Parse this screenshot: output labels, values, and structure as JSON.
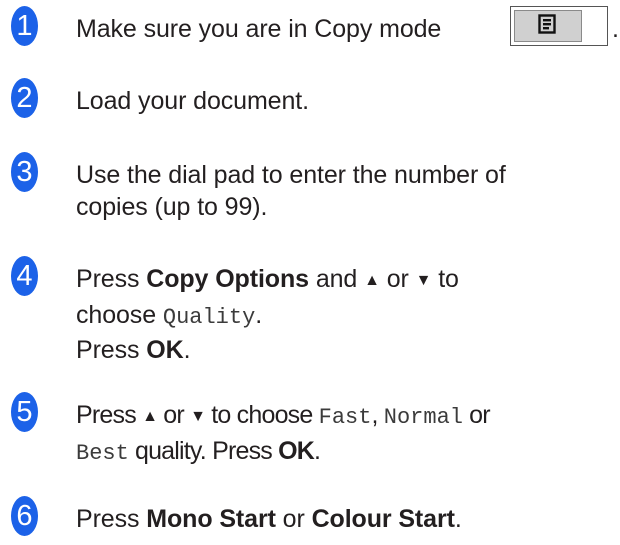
{
  "steps": [
    {
      "num": "1",
      "text": "Make sure you are in Copy mode",
      "period": "."
    },
    {
      "num": "2",
      "text": "Load your document."
    },
    {
      "num": "3",
      "line1": "Use the dial pad to enter the number of",
      "line2": "copies (up to 99)."
    },
    {
      "num": "4",
      "press": "Press",
      "copy_options": "Copy Options",
      "and": "and",
      "up_arrow": "▲",
      "or": "or",
      "down_arrow": "▼",
      "to": "to",
      "choose": "choose",
      "quality_option": "Quality",
      "period": ".",
      "press2": "Press",
      "ok": "OK",
      "period2": "."
    },
    {
      "num": "5",
      "press": "Press",
      "up_arrow": "▲",
      "or": "or",
      "down_arrow": "▼",
      "to_choose": "to choose",
      "fast": "Fast",
      "comma": ",",
      "normal": "Normal",
      "or2": "or",
      "best": "Best",
      "quality_press": "quality. Press",
      "ok": "OK",
      "period": "."
    },
    {
      "num": "6",
      "press": "Press",
      "mono_start": "Mono Start",
      "or": "or",
      "colour_start": "Colour Start",
      "period": "."
    }
  ],
  "icons": {
    "copy_mode_key": "copy-mode-icon"
  },
  "colors": {
    "badge": "#1c62e8",
    "text": "#231f20"
  }
}
